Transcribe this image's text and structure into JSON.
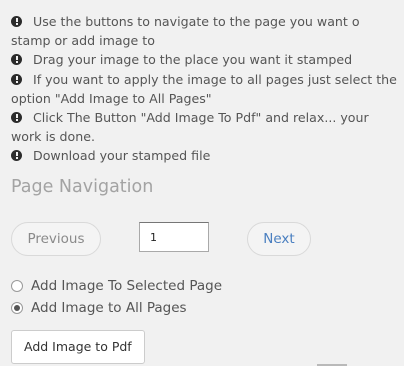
{
  "instructions": [
    {
      "icon": "info-circle-icon",
      "text": "Use the buttons to navigate to the page you want o stamp or add image to"
    },
    {
      "icon": "info-circle-icon",
      "text": "Drag your image to the place you want it stamped"
    },
    {
      "icon": "info-circle-icon",
      "text": "If you want to apply the image to all pages just select the option \"Add Image to All Pages\""
    },
    {
      "icon": "info-circle-icon",
      "text": "Click The Button \"Add Image To Pdf\" and relax... your work is done."
    },
    {
      "icon": "info-circle-icon",
      "text": "Download your stamped file"
    }
  ],
  "navigation": {
    "title": "Page Navigation",
    "previous_label": "Previous",
    "next_label": "Next",
    "page_value": "1"
  },
  "options": {
    "selected_page_label": "Add Image To Selected Page",
    "all_pages_label": "Add Image to All Pages",
    "selected": "all_pages"
  },
  "actions": {
    "add_image_label": "Add Image to Pdf"
  },
  "colors": {
    "background": "#f1f1f1",
    "text": "#555555",
    "title": "#a3a3a3",
    "next_link": "#4a7fc0"
  }
}
